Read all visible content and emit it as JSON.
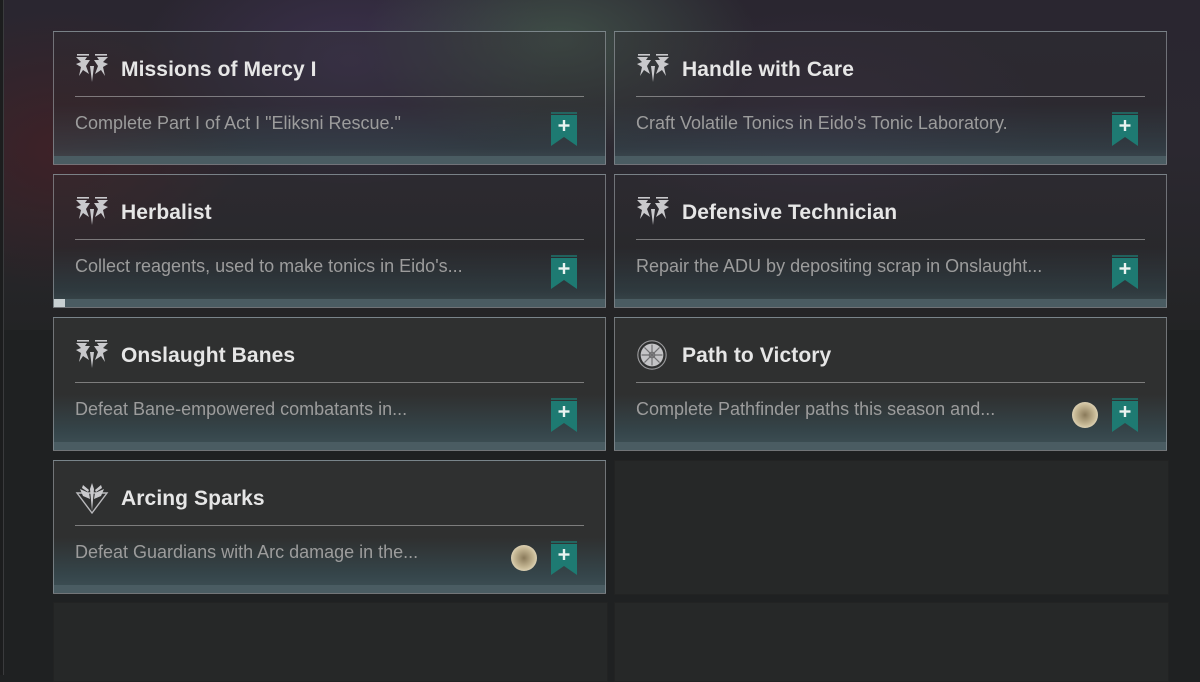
{
  "colors": {
    "accent_teal": "#1e7a72",
    "title_text": "#e6e6e6",
    "desc_text": "#9c9c9c",
    "progress_fill": "#c8d0d2"
  },
  "quests": [
    {
      "title": "Missions of Mercy I",
      "description": "Complete Part I of Act I \"Eliksni Rescue.\"",
      "icon": "eliksni-banner-icon",
      "reward_orb": false,
      "progress": 0
    },
    {
      "title": "Handle with Care",
      "description": "Craft Volatile Tonics in Eido's Tonic Laboratory.",
      "icon": "eliksni-banner-icon",
      "reward_orb": false,
      "progress": 0
    },
    {
      "title": "Herbalist",
      "description": "Collect reagents, used to make tonics in Eido's...",
      "icon": "eliksni-banner-icon",
      "reward_orb": false,
      "progress": 0.02
    },
    {
      "title": "Defensive Technician",
      "description": "Repair the ADU by depositing scrap in Onslaught...",
      "icon": "eliksni-banner-icon",
      "reward_orb": false,
      "progress": 0
    },
    {
      "title": "Onslaught Banes",
      "description": "Defeat Bane-empowered combatants in...",
      "icon": "eliksni-banner-icon",
      "reward_orb": false,
      "progress": 0
    },
    {
      "title": "Path to Victory",
      "description": "Complete Pathfinder paths this season and...",
      "icon": "pathfinder-emblem-icon",
      "reward_orb": true,
      "progress": 0
    },
    {
      "title": "Arcing Sparks",
      "description": "Defeat Guardians with Arc damage in the...",
      "icon": "crucible-emblem-icon",
      "reward_orb": true,
      "progress": 0
    }
  ],
  "track_button_symbol": "+"
}
